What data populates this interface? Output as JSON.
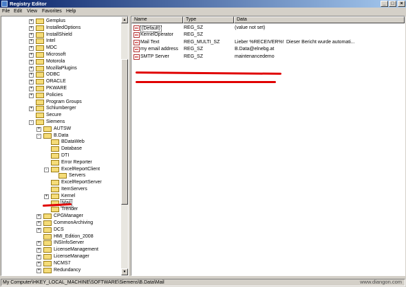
{
  "window": {
    "title": "Registry Editor",
    "controls": [
      "_",
      "□",
      "×"
    ]
  },
  "menu": [
    "File",
    "Edit",
    "View",
    "Favorites",
    "Help"
  ],
  "tree": [
    {
      "label": "Gemplus",
      "expander": "+"
    },
    {
      "label": "InstalledOptions",
      "expander": "+"
    },
    {
      "label": "InstallShield",
      "expander": "+"
    },
    {
      "label": "Intel",
      "expander": "+"
    },
    {
      "label": "MDC",
      "expander": "+"
    },
    {
      "label": "Microsoft",
      "expander": "+"
    },
    {
      "label": "Motorola",
      "expander": "+"
    },
    {
      "label": "MozillaPlugins",
      "expander": "+"
    },
    {
      "label": "ODBC",
      "expander": "+"
    },
    {
      "label": "ORACLE",
      "expander": "+"
    },
    {
      "label": "PKWARE",
      "expander": "+"
    },
    {
      "label": "Policies",
      "expander": "+"
    },
    {
      "label": "Program Groups",
      "expander": ""
    },
    {
      "label": "Schlumberger",
      "expander": "+"
    },
    {
      "label": "Secure",
      "expander": ""
    },
    {
      "label": "Siemens",
      "expander": "-"
    },
    {
      "label": "AUTSW",
      "expander": "+"
    },
    {
      "label": "B.Data",
      "expander": "-"
    },
    {
      "label": "BDataWeb",
      "expander": ""
    },
    {
      "label": "Database",
      "expander": ""
    },
    {
      "label": "DTI",
      "expander": ""
    },
    {
      "label": "Error Reporter",
      "expander": ""
    },
    {
      "label": "ExcelReportClient",
      "expander": "-"
    },
    {
      "label": "Servers",
      "expander": ""
    },
    {
      "label": "ExcelReportServer",
      "expander": ""
    },
    {
      "label": "ItemServers",
      "expander": ""
    },
    {
      "label": "Kernel",
      "expander": "+"
    },
    {
      "label": "Mail",
      "expander": "",
      "selected": true
    },
    {
      "label": "Trender",
      "expander": ""
    },
    {
      "label": "CPGManager",
      "expander": "+"
    },
    {
      "label": "CommonArchiving",
      "expander": "+"
    },
    {
      "label": "DCS",
      "expander": "+"
    },
    {
      "label": "HMI_Edition_2008",
      "expander": ""
    },
    {
      "label": "INSInfoServer",
      "expander": "+"
    },
    {
      "label": "LicenseManagement",
      "expander": "+"
    },
    {
      "label": "LicenseManager",
      "expander": "+"
    },
    {
      "label": "NCMS7",
      "expander": "+"
    },
    {
      "label": "Redundancy",
      "expander": "+"
    }
  ],
  "list": {
    "columns": [
      "Name",
      "Type",
      "Data"
    ],
    "rows": [
      {
        "name": "(Default)",
        "type": "REG_SZ",
        "data": "(value not set)",
        "extra": ""
      },
      {
        "name": "KernelOperator",
        "type": "REG_SZ",
        "data": "",
        "extra": ""
      },
      {
        "name": "Mail Text",
        "type": "REG_MULTI_SZ",
        "data": "Lieber %RECEIVER%!",
        "extra": "Dieser Bericht wurde automati..."
      },
      {
        "name": "my email address",
        "type": "REG_SZ",
        "data": "B.Data@elnebg.at",
        "extra": ""
      },
      {
        "name": "SMTP Server",
        "type": "REG_SZ",
        "data": "maintenancedemo",
        "extra": ""
      }
    ],
    "value_icon": "ab"
  },
  "status": "My Computer\\HKEY_LOCAL_MACHINE\\SOFTWARE\\Siemens\\B.Data\\Mail",
  "watermark": "www.diangon.com",
  "colors": {
    "annotation": "#e00000",
    "titlebar": "#0a246a"
  }
}
